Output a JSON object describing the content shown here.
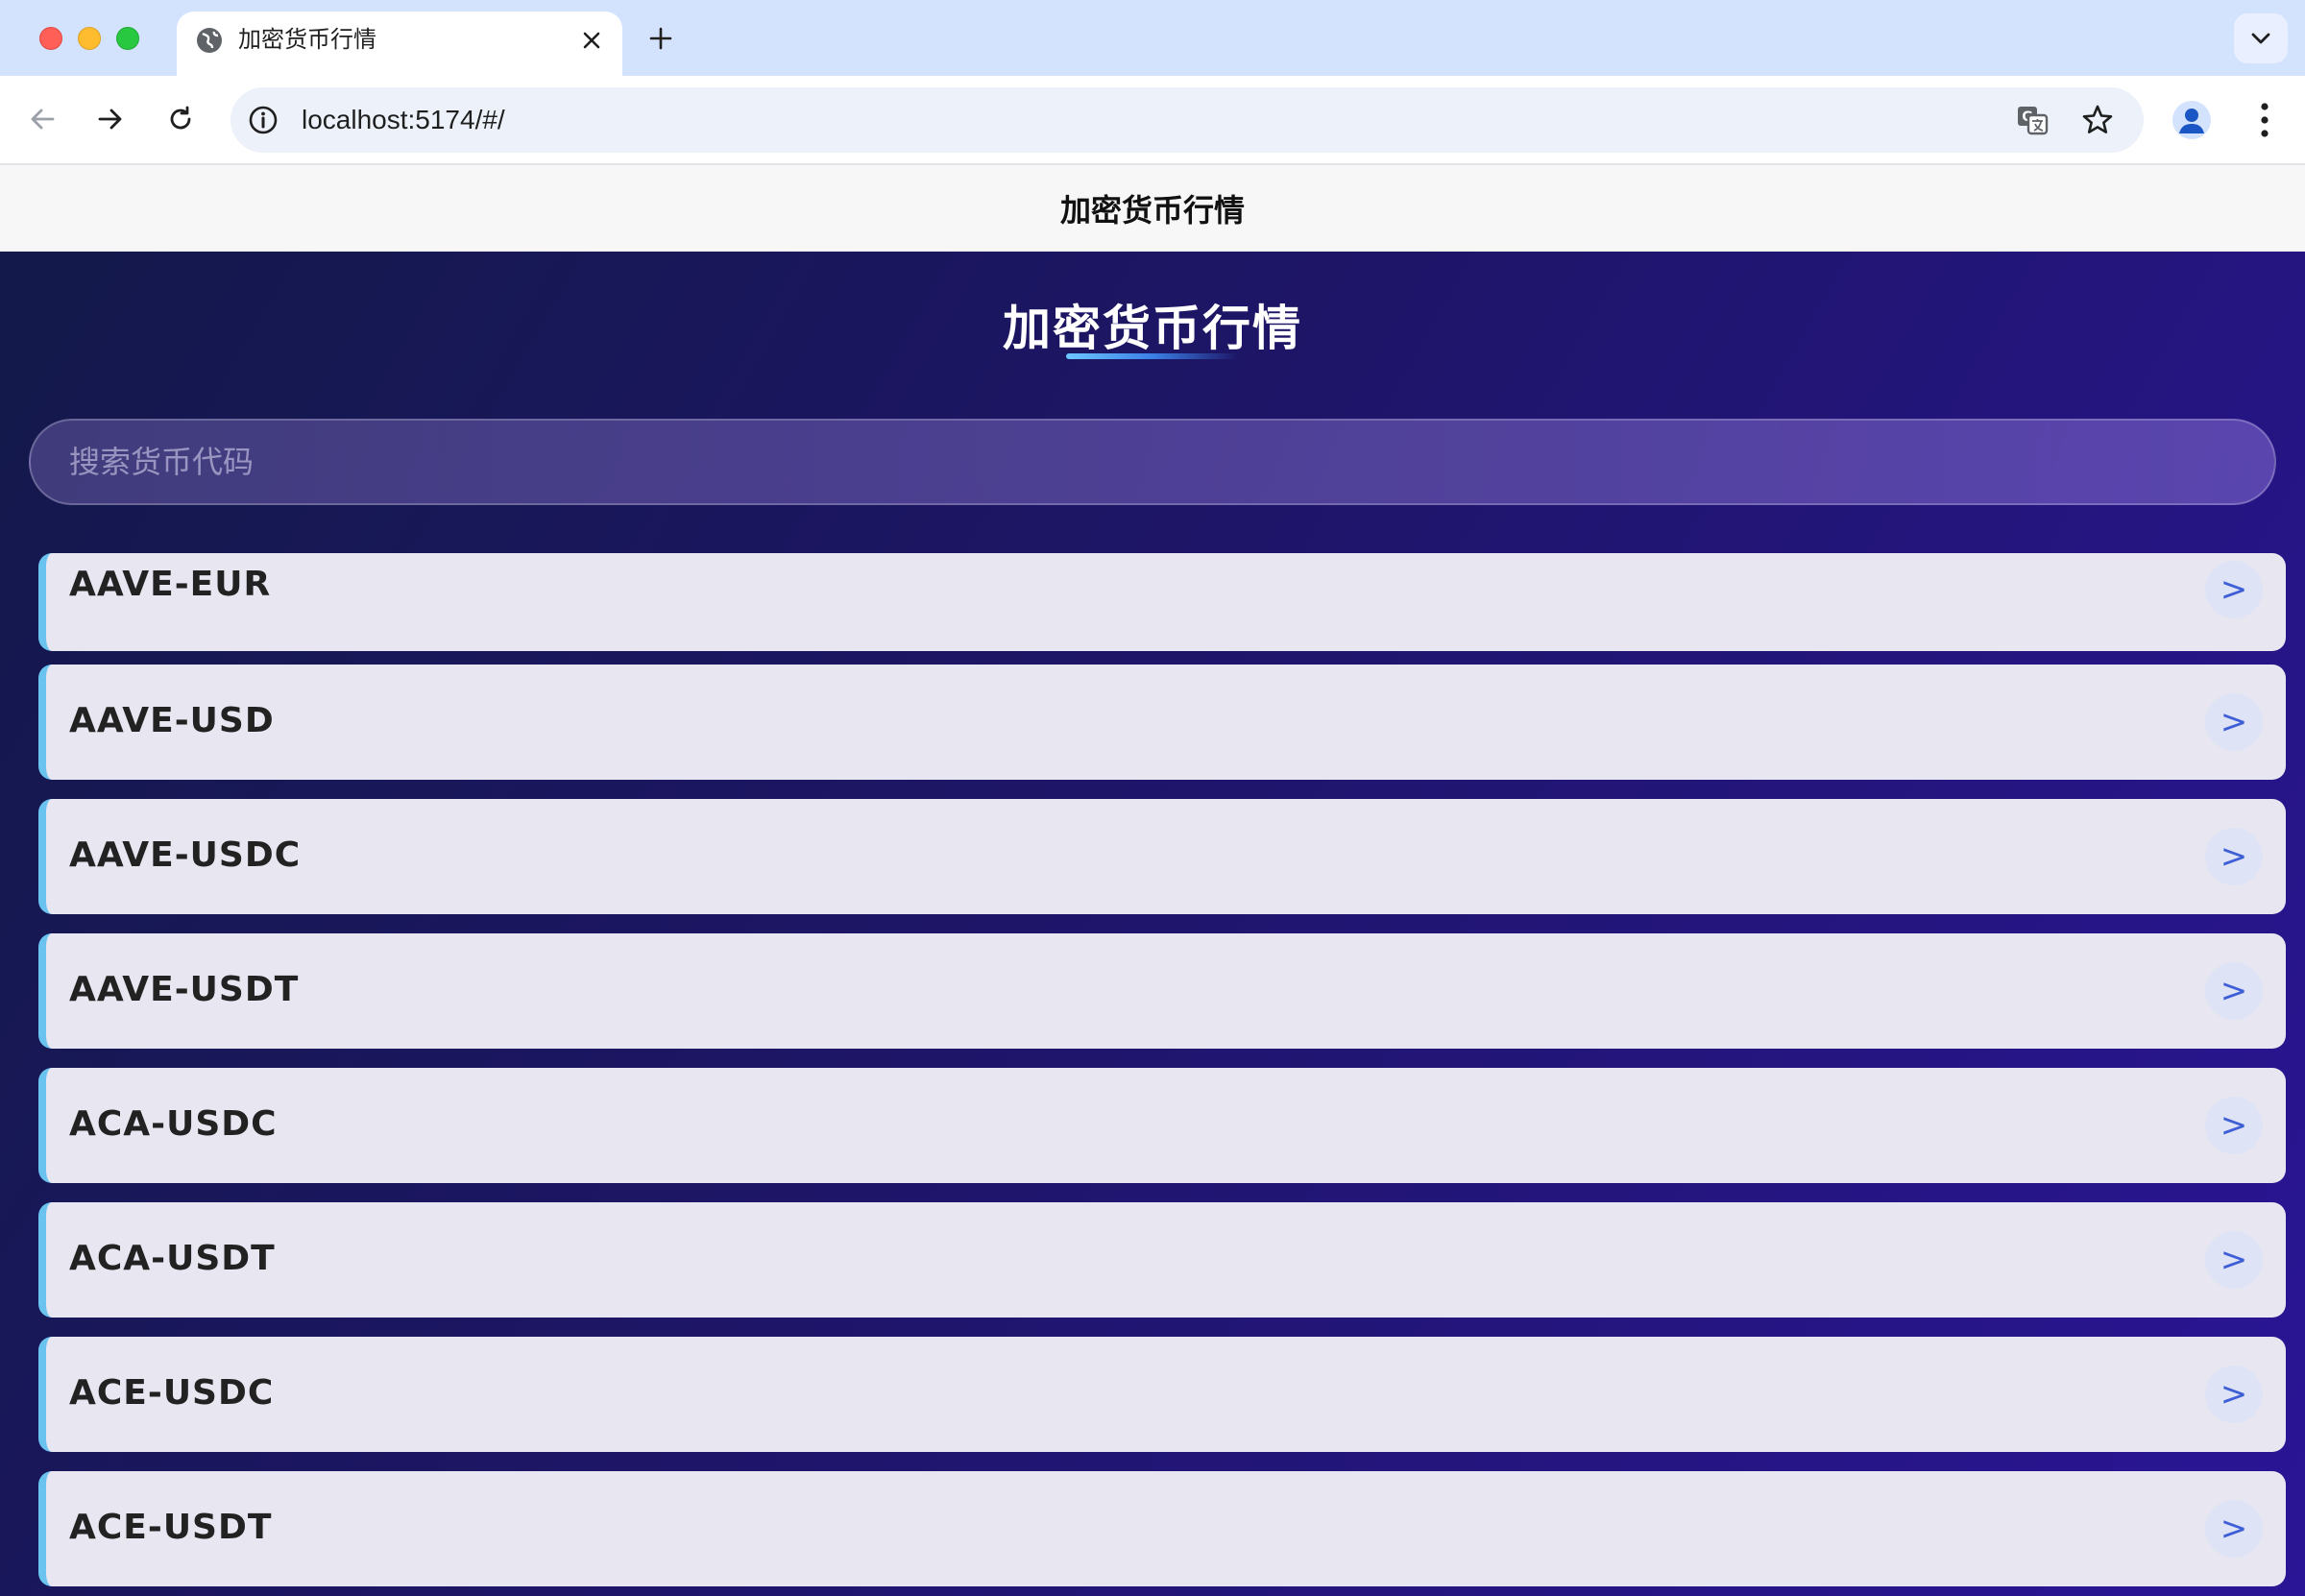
{
  "browser": {
    "tab_title": "加密货币行情",
    "url": "localhost:5174/#/"
  },
  "app": {
    "header_title": "加密货币行情",
    "hero_title": "加密货币行情",
    "search_placeholder": "搜索货币代码",
    "arrow_label": ">",
    "items": [
      {
        "label": "AAVE-EUR"
      },
      {
        "label": "AAVE-USD"
      },
      {
        "label": "AAVE-USDC"
      },
      {
        "label": "AAVE-USDT"
      },
      {
        "label": "ACA-USDC"
      },
      {
        "label": "ACA-USDT"
      },
      {
        "label": "ACE-USDC"
      },
      {
        "label": "ACE-USDT"
      }
    ]
  },
  "colors": {
    "accent": "#6ac2ee",
    "arrow": "#3f5fd6",
    "bg_start": "#13194a",
    "bg_end": "#2a1596"
  }
}
